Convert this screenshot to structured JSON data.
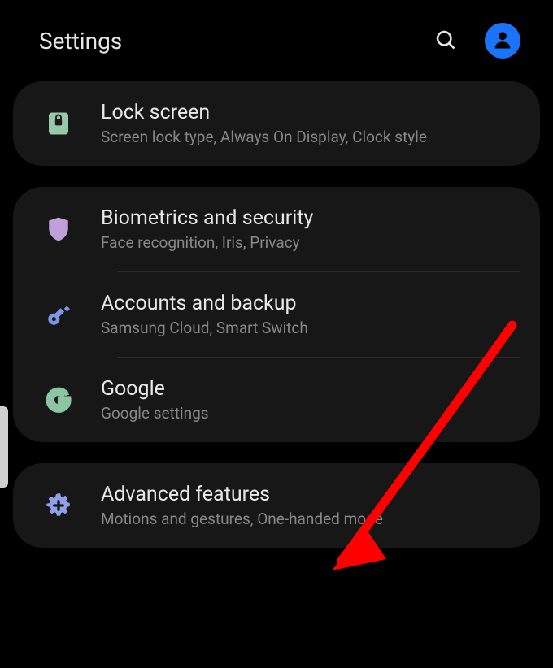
{
  "header": {
    "title": "Settings"
  },
  "colors": {
    "profile_bg": "#1a73f8",
    "lock_icon": "#97c9a9",
    "shield_icon": "#bfa0db",
    "key_icon": "#7c95e4",
    "google_icon": "#8cc5a1",
    "gear_icon": "#8ea0e8",
    "arrow": "#ff0000"
  },
  "groups": [
    {
      "items": [
        {
          "id": "lock-screen",
          "icon": "lock",
          "title": "Lock screen",
          "subtitle": "Screen lock type, Always On Display, Clock style"
        }
      ]
    },
    {
      "items": [
        {
          "id": "biometrics",
          "icon": "shield",
          "title": "Biometrics and security",
          "subtitle": "Face recognition, Iris, Privacy"
        },
        {
          "id": "accounts",
          "icon": "key",
          "title": "Accounts and backup",
          "subtitle": "Samsung Cloud, Smart Switch"
        },
        {
          "id": "google",
          "icon": "google",
          "title": "Google",
          "subtitle": "Google settings"
        }
      ]
    },
    {
      "items": [
        {
          "id": "advanced",
          "icon": "gear",
          "title": "Advanced features",
          "subtitle": "Motions and gestures, One-handed mode"
        }
      ]
    }
  ]
}
